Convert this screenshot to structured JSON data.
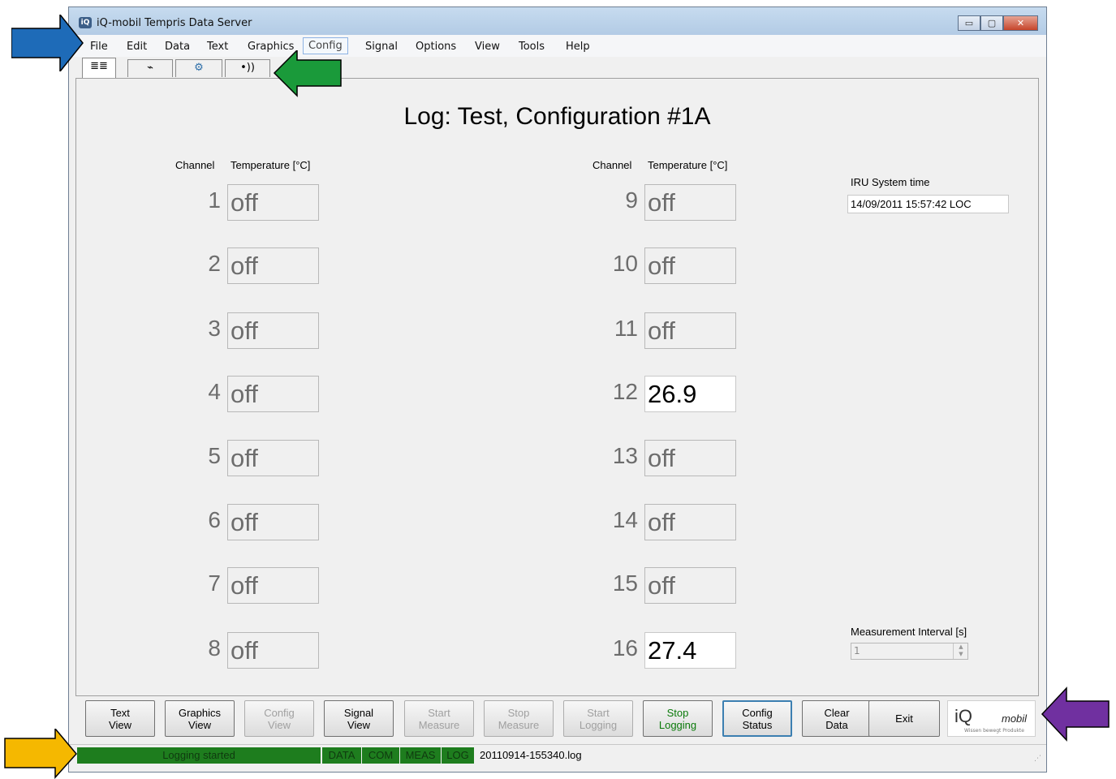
{
  "window": {
    "title": "iQ-mobil Tempris Data Server",
    "app_icon": "iQ",
    "buttons": {
      "minimize": "▭",
      "maximize": "▢",
      "close": "✕"
    }
  },
  "menu": [
    "File",
    "Edit",
    "Data",
    "Text",
    "Graphics",
    "Config",
    "Signal",
    "Options",
    "View",
    "Tools",
    "Help"
  ],
  "tabs": [
    {
      "icon": "table-view-icon",
      "label": "≣≣"
    },
    {
      "icon": "graph-view-icon",
      "label": "⌁"
    },
    {
      "icon": "config-view-icon",
      "label": "⚙"
    },
    {
      "icon": "signal-view-icon",
      "label": "•))"
    }
  ],
  "main": {
    "title": "Log: Test, Configuration #1A",
    "headers": {
      "channel": "Channel",
      "temperature": "Temperature [°C]"
    },
    "channels": [
      {
        "num": "1",
        "value": "off",
        "live": false
      },
      {
        "num": "2",
        "value": "off",
        "live": false
      },
      {
        "num": "3",
        "value": "off",
        "live": false
      },
      {
        "num": "4",
        "value": "off",
        "live": false
      },
      {
        "num": "5",
        "value": "off",
        "live": false
      },
      {
        "num": "6",
        "value": "off",
        "live": false
      },
      {
        "num": "7",
        "value": "off",
        "live": false
      },
      {
        "num": "8",
        "value": "off",
        "live": false
      },
      {
        "num": "9",
        "value": "off",
        "live": false
      },
      {
        "num": "10",
        "value": "off",
        "live": false
      },
      {
        "num": "11",
        "value": "off",
        "live": false
      },
      {
        "num": "12",
        "value": "26.9",
        "live": true
      },
      {
        "num": "13",
        "value": "off",
        "live": false
      },
      {
        "num": "14",
        "value": "off",
        "live": false
      },
      {
        "num": "15",
        "value": "off",
        "live": false
      },
      {
        "num": "16",
        "value": "27.4",
        "live": true
      }
    ],
    "iru": {
      "label": "IRU System time",
      "value": "14/09/2011 15:57:42 LOC"
    },
    "interval": {
      "label": "Measurement Interval [s]",
      "value": "1"
    }
  },
  "buttons": [
    {
      "name": "text-view-button",
      "label": "Text\nView",
      "state": "normal"
    },
    {
      "name": "graphics-view-button",
      "label": "Graphics\nView",
      "state": "normal"
    },
    {
      "name": "config-view-button",
      "label": "Config\nView",
      "state": "disabled"
    },
    {
      "name": "signal-view-button",
      "label": "Signal\nView",
      "state": "normal"
    },
    {
      "name": "start-measure-button",
      "label": "Start\nMeasure",
      "state": "disabled"
    },
    {
      "name": "stop-measure-button",
      "label": "Stop\nMeasure",
      "state": "disabled"
    },
    {
      "name": "start-logging-button",
      "label": "Start\nLogging",
      "state": "disabled"
    },
    {
      "name": "stop-logging-button",
      "label": "Stop\nLogging",
      "state": "green"
    },
    {
      "name": "config-status-button",
      "label": "Config\nStatus",
      "state": "focus"
    },
    {
      "name": "clear-data-button",
      "label": "Clear\nData",
      "state": "normal"
    },
    {
      "name": "exit-button",
      "label": "Exit",
      "state": "normal"
    }
  ],
  "logo": {
    "brand": "iQ",
    "mobil": "mobil",
    "tagline": "Wissen bewegt Produkte"
  },
  "status": {
    "message": "Logging started",
    "tags": [
      "DATA",
      "COM",
      "MEAS",
      "LOG"
    ],
    "file": "20110914-155340.log"
  },
  "colors": {
    "arrow_menu": "#1e6bb8",
    "arrow_tabs": "#1a9a3a",
    "arrow_logo": "#7030a0",
    "arrow_status": "#f5b800",
    "status_green": "#1e7d1e"
  }
}
